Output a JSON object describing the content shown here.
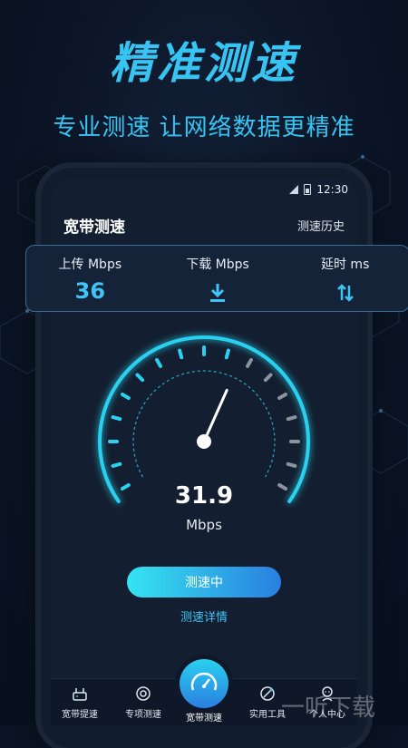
{
  "promo": {
    "headline": "精准测速",
    "subline": "专业测速 让网络数据更精准"
  },
  "status": {
    "time": "12:30"
  },
  "appbar": {
    "title": "宽带测速",
    "history": "测速历史"
  },
  "stats": [
    {
      "label": "上传 Mbps",
      "value": "36"
    },
    {
      "label": "下载 Mbps",
      "icon": "download-icon"
    },
    {
      "label": "延时 ms",
      "icon": "swap-vertical-icon"
    }
  ],
  "gauge": {
    "speed": "31.9",
    "unit": "Mbps",
    "needle_fraction": 0.6
  },
  "actions": {
    "testing": "测速中",
    "details": "测速详情"
  },
  "tabs": [
    {
      "label": "宽带提速",
      "icon": "router-icon"
    },
    {
      "label": "专项测速",
      "icon": "target-icon"
    },
    {
      "label": "宽带测速",
      "icon": "speedometer-icon"
    },
    {
      "label": "实用工具",
      "icon": "tools-icon"
    },
    {
      "label": "个人中心",
      "icon": "person-icon"
    }
  ],
  "watermark": "一听下载",
  "colors": {
    "accent": "#3ec4f5",
    "background": "#0b1424"
  }
}
